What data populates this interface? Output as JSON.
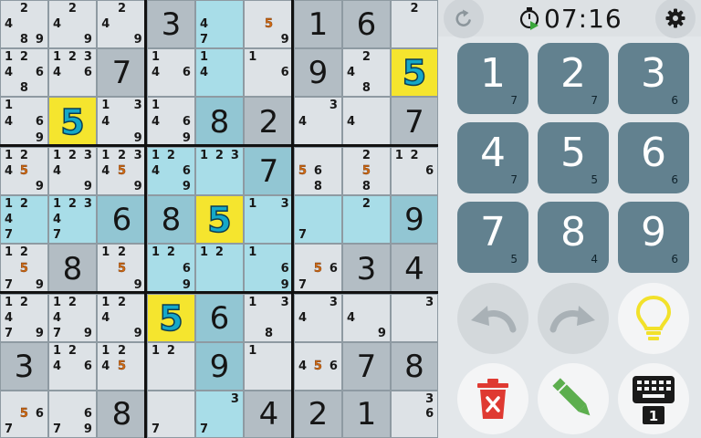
{
  "board": {
    "rows": [
      [
        {
          "n": [
            "",
            "2",
            "",
            "4",
            "",
            "",
            "",
            "8",
            "9"
          ]
        },
        {
          "n": [
            "",
            "2",
            "",
            "4",
            "",
            "",
            "",
            "",
            "9"
          ]
        },
        {
          "n": [
            "",
            "2",
            "",
            "4",
            "",
            "",
            "",
            "",
            "9"
          ]
        },
        {
          "v": "3"
        },
        {
          "n": [
            "",
            "",
            "",
            "4",
            "",
            "",
            "7",
            "",
            ""
          ]
        },
        {
          "n": [
            "",
            "",
            "",
            "",
            "5",
            "",
            "",
            "",
            "9"
          ],
          "h": [
            "5"
          ]
        },
        {
          "v": "1"
        },
        {
          "v": "6"
        },
        {
          "n": [
            "",
            "2",
            "",
            "",
            "",
            "",
            "",
            "",
            ""
          ]
        }
      ],
      [
        {
          "n": [
            "1",
            "2",
            "",
            "4",
            "",
            "6",
            "",
            "8",
            ""
          ]
        },
        {
          "n": [
            "1",
            "2",
            "3",
            "4",
            "",
            "6",
            "",
            "",
            ""
          ]
        },
        {
          "v": "7"
        },
        {
          "n": [
            "1",
            "",
            "",
            "4",
            "",
            "6",
            "",
            "",
            ""
          ]
        },
        {
          "n": [
            "1",
            "",
            "",
            "4",
            "",
            "",
            "",
            "",
            ""
          ]
        },
        {
          "n": [
            "1",
            "",
            "",
            "",
            "",
            "6",
            "",
            "",
            ""
          ]
        },
        {
          "v": "9"
        },
        {
          "n": [
            "",
            "2",
            "",
            "4",
            "",
            "",
            "",
            "8",
            ""
          ]
        },
        {
          "v": "5",
          "sel": true
        }
      ],
      [
        {
          "n": [
            "1",
            "",
            "",
            "4",
            "",
            "6",
            "",
            "",
            "9"
          ]
        },
        {
          "v": "5",
          "sel": true
        },
        {
          "n": [
            "1",
            "",
            "3",
            "4",
            "",
            "",
            "",
            "",
            "9"
          ]
        },
        {
          "n": [
            "1",
            "",
            "",
            "4",
            "",
            "6",
            "",
            "",
            "9"
          ]
        },
        {
          "v": "8"
        },
        {
          "v": "2"
        },
        {
          "n": [
            "",
            "",
            "3",
            "4",
            "",
            "",
            "",
            "",
            ""
          ]
        },
        {
          "n": [
            "",
            "",
            "",
            "4",
            "",
            "",
            "",
            "",
            ""
          ]
        },
        {
          "v": "7"
        }
      ],
      [
        {
          "n": [
            "1",
            "2",
            "",
            "4",
            "5",
            "",
            "",
            "",
            "9"
          ],
          "h": [
            "5"
          ]
        },
        {
          "n": [
            "1",
            "2",
            "3",
            "4",
            "",
            "",
            "",
            "",
            "9"
          ]
        },
        {
          "n": [
            "1",
            "2",
            "3",
            "4",
            "5",
            "",
            "",
            "",
            "9"
          ],
          "h": [
            "5"
          ]
        },
        {
          "n": [
            "1",
            "2",
            "",
            "4",
            "",
            "6",
            "",
            "",
            "9"
          ]
        },
        {
          "n": [
            "1",
            "2",
            "3",
            "",
            "",
            "",
            "",
            "",
            ""
          ]
        },
        {
          "v": "7"
        },
        {
          "n": [
            "",
            "",
            "",
            "5",
            "6",
            "",
            "",
            "8",
            ""
          ],
          "h": [
            "5"
          ]
        },
        {
          "n": [
            "",
            "2",
            "",
            "",
            "5",
            "",
            "",
            "8",
            ""
          ],
          "h": [
            "5"
          ]
        },
        {
          "n": [
            "1",
            "2",
            "",
            "",
            "",
            "6",
            "",
            "",
            ""
          ]
        }
      ],
      [
        {
          "n": [
            "1",
            "2",
            "",
            "4",
            "",
            "",
            "7",
            "",
            ""
          ]
        },
        {
          "n": [
            "1",
            "2",
            "3",
            "4",
            "",
            "",
            "7",
            "",
            ""
          ]
        },
        {
          "v": "6"
        },
        {
          "v": "8"
        },
        {
          "v": "5",
          "sel": true
        },
        {
          "n": [
            "1",
            "",
            "3",
            "",
            "",
            "",
            "",
            "",
            ""
          ]
        },
        {
          "n": [
            "",
            "",
            "",
            "",
            "",
            "",
            "7",
            "",
            ""
          ]
        },
        {
          "n": [
            "",
            "2",
            "",
            "",
            "",
            "",
            "",
            "",
            ""
          ]
        },
        {
          "v": "9"
        }
      ],
      [
        {
          "n": [
            "1",
            "2",
            "",
            "",
            "5",
            "",
            "7",
            "",
            "9"
          ],
          "h": [
            "5"
          ]
        },
        {
          "v": "8"
        },
        {
          "n": [
            "1",
            "2",
            "",
            "",
            "5",
            "",
            "",
            "",
            "9"
          ],
          "h": [
            "5"
          ]
        },
        {
          "n": [
            "1",
            "2",
            "",
            "",
            "",
            "6",
            "",
            "",
            "9"
          ]
        },
        {
          "n": [
            "1",
            "2",
            "",
            "",
            "",
            "",
            "",
            "",
            ""
          ]
        },
        {
          "n": [
            "1",
            "",
            "",
            "",
            "",
            "6",
            "",
            "",
            "9"
          ]
        },
        {
          "n": [
            "",
            "",
            "",
            "",
            "5",
            "6",
            "7",
            "",
            ""
          ],
          "h": [
            "5"
          ]
        },
        {
          "v": "3"
        },
        {
          "v": "4"
        }
      ],
      [
        {
          "n": [
            "1",
            "2",
            "",
            "4",
            "",
            "",
            "7",
            "",
            "9"
          ]
        },
        {
          "n": [
            "1",
            "2",
            "",
            "4",
            "",
            "",
            "7",
            "",
            "9"
          ]
        },
        {
          "n": [
            "1",
            "2",
            "",
            "4",
            "",
            "",
            "",
            "",
            "9"
          ]
        },
        {
          "v": "5",
          "sel": true
        },
        {
          "v": "6"
        },
        {
          "n": [
            "1",
            "",
            "3",
            "",
            "",
            "",
            "",
            "8",
            ""
          ]
        },
        {
          "n": [
            "",
            "",
            "3",
            "4",
            "",
            "",
            "",
            "",
            ""
          ]
        },
        {
          "n": [
            "",
            "",
            "",
            "4",
            "",
            "",
            "",
            "",
            "9"
          ]
        },
        {
          "n": [
            "",
            "",
            "3",
            "",
            "",
            "",
            "",
            "",
            ""
          ]
        }
      ],
      [
        {
          "v": "3"
        },
        {
          "n": [
            "1",
            "2",
            "",
            "4",
            "",
            "6",
            "",
            "",
            ""
          ]
        },
        {
          "n": [
            "1",
            "2",
            "",
            "4",
            "5",
            "",
            "",
            "",
            ""
          ],
          "h": [
            "5"
          ]
        },
        {
          "n": [
            "1",
            "2",
            "",
            "",
            "",
            "",
            "",
            "",
            ""
          ]
        },
        {
          "v": "9"
        },
        {
          "n": [
            "1",
            "",
            "",
            "",
            "",
            "",
            "",
            "",
            ""
          ]
        },
        {
          "n": [
            "",
            "",
            "",
            "4",
            "5",
            "6",
            "",
            "",
            ""
          ],
          "h": [
            "5"
          ]
        },
        {
          "v": "7"
        },
        {
          "v": "8"
        }
      ],
      [
        {
          "n": [
            "",
            "",
            "",
            "",
            "5",
            "6",
            "7",
            "",
            ""
          ],
          "h": [
            "5"
          ]
        },
        {
          "n": [
            "",
            "",
            "",
            "",
            "",
            "6",
            "7",
            "",
            "9"
          ]
        },
        {
          "v": "8"
        },
        {
          "n": [
            "",
            "",
            "",
            "",
            "",
            "",
            "7",
            "",
            ""
          ]
        },
        {
          "n": [
            "",
            "",
            "3",
            "",
            "",
            "",
            "7",
            "",
            ""
          ]
        },
        {
          "v": "4"
        },
        {
          "v": "2"
        },
        {
          "v": "1"
        },
        {
          "n": [
            "",
            "",
            "3",
            "",
            "",
            "6",
            "",
            "",
            ""
          ]
        }
      ]
    ]
  },
  "toolbar": {
    "icons": [
      "restart-icon",
      "stopwatch-icon",
      "gear-icon"
    ],
    "timer": "07:16"
  },
  "keypad": [
    {
      "digit": "1",
      "count": "7"
    },
    {
      "digit": "2",
      "count": "7"
    },
    {
      "digit": "3",
      "count": "6"
    },
    {
      "digit": "4",
      "count": "7"
    },
    {
      "digit": "5",
      "count": "5"
    },
    {
      "digit": "6",
      "count": "6"
    },
    {
      "digit": "7",
      "count": "5"
    },
    {
      "digit": "8",
      "count": "4"
    },
    {
      "digit": "9",
      "count": "6"
    }
  ],
  "actions": {
    "icons": [
      "undo-icon",
      "redo-icon",
      "hint-bulb-icon",
      "erase-icon",
      "pencil-icon",
      "keyboard-mode-icon"
    ],
    "keyboard_badge": "1"
  },
  "colors": {
    "selected_value": "#14a8c8",
    "highlight_note": "#d06a12",
    "selected_cell_bg": "#f5e52e",
    "key_bg": "#62818f",
    "erase_red": "#df3a32",
    "pencil_green": "#5cae4e",
    "bulb_yellow": "#f2e12a"
  }
}
